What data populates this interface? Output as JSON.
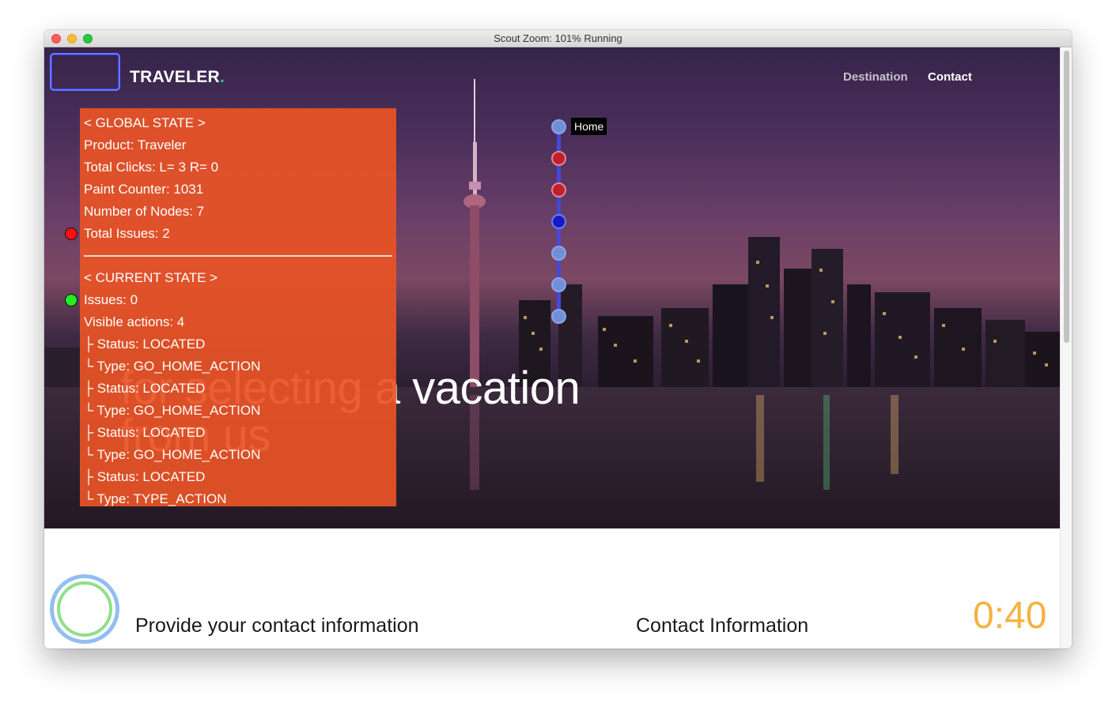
{
  "window": {
    "title": "Scout  Zoom: 101%  Running"
  },
  "header": {
    "brand": "TRAVELER",
    "brand_dot": ".",
    "nav": [
      "Destination",
      "Contact"
    ]
  },
  "hero": {
    "title_line1": "for selecting a vacation",
    "title_line2": "from us"
  },
  "global_state": {
    "heading": "< GLOBAL STATE >",
    "product": "Product: Traveler",
    "total_clicks": "Total Clicks: L= 3 R= 0",
    "paint_counter": "Paint Counter: 1031",
    "nodes": "Number of Nodes: 7",
    "issues": "Total Issues: 2"
  },
  "current_state": {
    "heading": "< CURRENT STATE >",
    "issues": "Issues: 0",
    "visible_actions": "Visible actions: 4",
    "actions": [
      {
        "status": "├ Status: LOCATED",
        "type": "└ Type: GO_HOME_ACTION"
      },
      {
        "status": "├ Status: LOCATED",
        "type": "└ Type: GO_HOME_ACTION"
      },
      {
        "status": "├ Status: LOCATED",
        "type": "└ Type: GO_HOME_ACTION"
      },
      {
        "status": "├ Status: LOCATED",
        "type": "└ Type: TYPE_ACTION"
      }
    ]
  },
  "state_graph": {
    "home_label": "Home",
    "nodes": [
      "visited",
      "issue",
      "issue",
      "current",
      "visited",
      "visited",
      "visited"
    ]
  },
  "indicators": {
    "global_issue_color": "#ff1010",
    "current_ok_color": "#22ee22"
  },
  "footer": {
    "task": "Provide your contact information",
    "section": "Contact Information",
    "timer": "0:40"
  }
}
